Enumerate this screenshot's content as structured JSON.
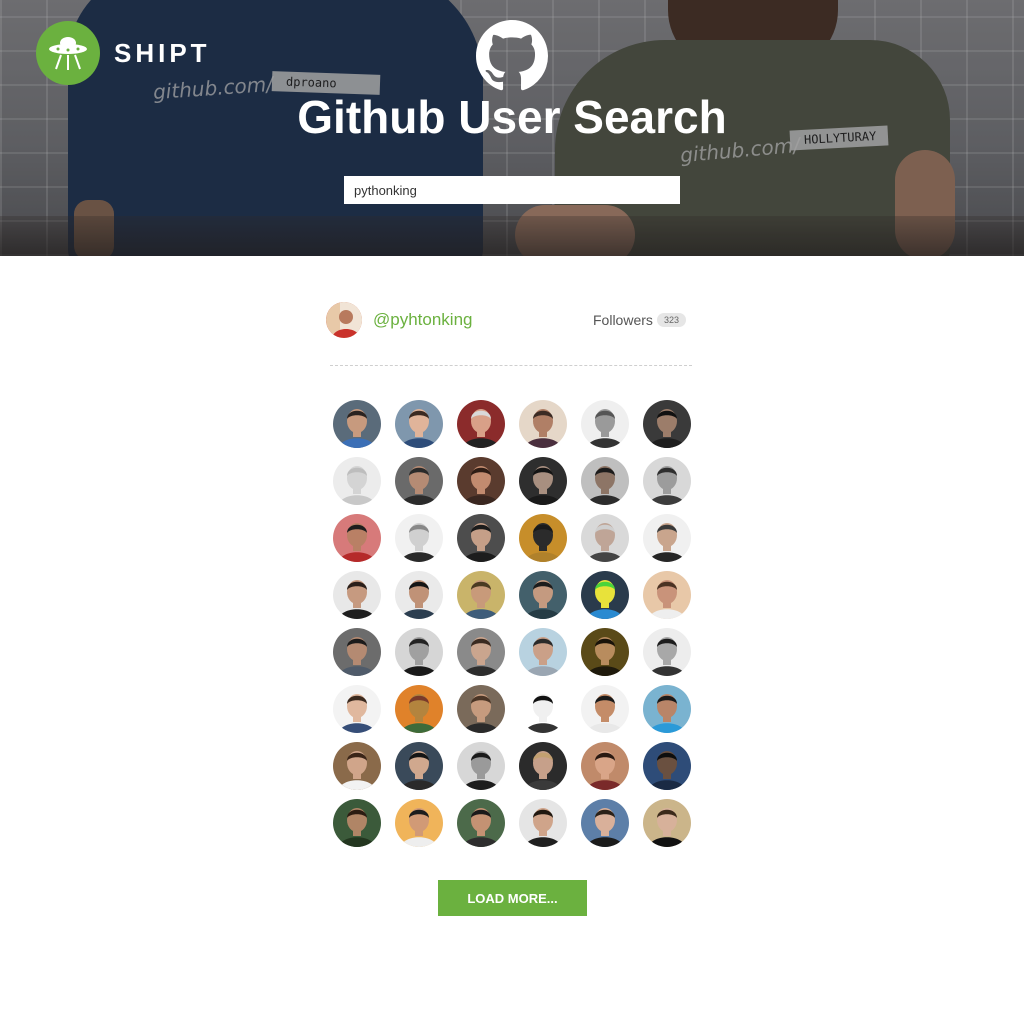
{
  "hero": {
    "brand": "SHIPT",
    "title": "Github User Search",
    "shirt_left_text": "github.com/",
    "shirt_left_tag": "dproano",
    "shirt_right_text": "github.com/",
    "shirt_right_tag": "HOLLYTURAY"
  },
  "search": {
    "value": "pythonking"
  },
  "profile": {
    "username": "@pyhtonking",
    "followers_label": "Followers",
    "followers_count": "323"
  },
  "followers": [
    {
      "bg": "#5a6b7a",
      "skin": "#c79a7e",
      "shirt": "#3b6fb6",
      "hair": "#2a2320"
    },
    {
      "bg": "#7f97ad",
      "skin": "#e0b49a",
      "shirt": "#2e4d7a",
      "hair": "#3a2a22"
    },
    {
      "bg": "#8b2b2b",
      "skin": "#d8a088",
      "shirt": "#222222",
      "hair": "#d9d9d9"
    },
    {
      "bg": "#e5d7c8",
      "skin": "#b07f66",
      "shirt": "#4a2f3e",
      "hair": "#3b2b24"
    },
    {
      "bg": "#efefef",
      "skin": "#9a9a9a",
      "shirt": "#333333",
      "hair": "#555555"
    },
    {
      "bg": "#3a3a3a",
      "skin": "#9c7d6a",
      "shirt": "#1e1e1e",
      "hair": "#111111"
    },
    {
      "bg": "#ececec",
      "skin": "#d4d4d4",
      "shirt": "#c8c8c8",
      "hair": "#bdbdbd"
    },
    {
      "bg": "#6a6a6a",
      "skin": "#b58b74",
      "shirt": "#2b2b2b",
      "hair": "#2a2a2a"
    },
    {
      "bg": "#5a3b2e",
      "skin": "#c28b6f",
      "shirt": "#3a2720",
      "hair": "#2f1d15"
    },
    {
      "bg": "#2e2e2e",
      "skin": "#a88f80",
      "shirt": "#1a1a1a",
      "hair": "#141414"
    },
    {
      "bg": "#bfbfbf",
      "skin": "#8d7566",
      "shirt": "#2c2c2c",
      "hair": "#1c1c1c"
    },
    {
      "bg": "#d8d8d8",
      "skin": "#9c9c9c",
      "shirt": "#3c3c3c",
      "hair": "#2e2e2e"
    },
    {
      "bg": "#d77a7a",
      "skin": "#b98065",
      "shirt": "#b52a2a",
      "hair": "#1e1e1e"
    },
    {
      "bg": "#f1f1f1",
      "skin": "#d0d0d0",
      "shirt": "#2a2a2a",
      "hair": "#888888"
    },
    {
      "bg": "#4d4d4d",
      "skin": "#c59f88",
      "shirt": "#1d1d1d",
      "hair": "#1b1b1b"
    },
    {
      "bg": "#c78e2a",
      "skin": "#2b2b2b",
      "shirt": "#b0812b",
      "hair": "#1a1a1a"
    },
    {
      "bg": "#d9d9d9",
      "skin": "#bfa597",
      "shirt": "#444444",
      "hair": "#cfcfcf"
    },
    {
      "bg": "#f0f0f0",
      "skin": "#c9a58d",
      "shirt": "#262626",
      "hair": "#3a3a3a"
    },
    {
      "bg": "#e8e8e8",
      "skin": "#c69a80",
      "shirt": "#1f1f1f",
      "hair": "#2a1f1a"
    },
    {
      "bg": "#eaeaea",
      "skin": "#c09277",
      "shirt": "#2c3e50",
      "hair": "#151515"
    },
    {
      "bg": "#c9b46a",
      "skin": "#c89a7a",
      "shirt": "#3f5d7a",
      "hair": "#4a3a22"
    },
    {
      "bg": "#43606b",
      "skin": "#c49a80",
      "shirt": "#263c45",
      "hair": "#1c1c1c"
    },
    {
      "bg": "#2a3b4c",
      "skin": "#e8e23a",
      "shirt": "#2a8ad1",
      "hair": "#4bd43a"
    },
    {
      "bg": "#e8c8a8",
      "skin": "#c9937a",
      "shirt": "#eeeeee",
      "hair": "#4a3223"
    },
    {
      "bg": "#6c6c6c",
      "skin": "#b48a72",
      "shirt": "#4f5b6a",
      "hair": "#1b1b1b"
    },
    {
      "bg": "#d6d6d6",
      "skin": "#a0a0a0",
      "shirt": "#1a1a1a",
      "hair": "#222222"
    },
    {
      "bg": "#8a8a8a",
      "skin": "#caa58e",
      "shirt": "#2d2d2d",
      "hair": "#3a2a20"
    },
    {
      "bg": "#b8d2e0",
      "skin": "#caa088",
      "shirt": "#9aa6b2",
      "hair": "#2a2a2a"
    },
    {
      "bg": "#5a4a18",
      "skin": "#b88c5e",
      "shirt": "#1f1a0c",
      "hair": "#191309"
    },
    {
      "bg": "#ededed",
      "skin": "#a8a8a8",
      "shirt": "#333333",
      "hair": "#1d1d1d"
    },
    {
      "bg": "#f3f3f3",
      "skin": "#e0b89e",
      "shirt": "#364e78",
      "hair": "#3b2a1f"
    },
    {
      "bg": "#e0822a",
      "skin": "#b3843e",
      "shirt": "#3d6b3a",
      "hair": "#7a3a2a"
    },
    {
      "bg": "#7a6a5a",
      "skin": "#c69b7e",
      "shirt": "#2a2a2a",
      "hair": "#4a3526"
    },
    {
      "bg": "#ffffff",
      "skin": "#f0f0f0",
      "shirt": "#333333",
      "hair": "#111111"
    },
    {
      "bg": "#f2f2f2",
      "skin": "#c48c68",
      "shirt": "#e8e8e8",
      "hair": "#1a1a1a"
    },
    {
      "bg": "#7ab3d0",
      "skin": "#b98568",
      "shirt": "#2b9ad8",
      "hair": "#1a1a1a"
    },
    {
      "bg": "#8a6a4a",
      "skin": "#d0a58a",
      "shirt": "#f2f2f2",
      "hair": "#3a2518"
    },
    {
      "bg": "#3a4a5a",
      "skin": "#d0a88e",
      "shirt": "#2a2a2a",
      "hair": "#151515"
    },
    {
      "bg": "#d7d7d7",
      "skin": "#9a9a9a",
      "shirt": "#1d1d1d",
      "hair": "#1a1a1a"
    },
    {
      "bg": "#2b2b2b",
      "skin": "#c6a08a",
      "shirt": "#3a3a3a",
      "hair": "#c2a070"
    },
    {
      "bg": "#c08a6a",
      "skin": "#d9a588",
      "shirt": "#7a2a2a",
      "hair": "#2a1a12"
    },
    {
      "bg": "#2e4c78",
      "skin": "#6a5040",
      "shirt": "#1a2a44",
      "hair": "#0d0d0d"
    },
    {
      "bg": "#3b5a3a",
      "skin": "#b08566",
      "shirt": "#23361f",
      "hair": "#2b1c12"
    },
    {
      "bg": "#f0b45a",
      "skin": "#d19a76",
      "shirt": "#eeeeee",
      "hair": "#1d1d1d"
    },
    {
      "bg": "#4c6a4a",
      "skin": "#c49273",
      "shirt": "#2e2e2e",
      "hair": "#1a1a1a"
    },
    {
      "bg": "#e5e5e5",
      "skin": "#cfa48a",
      "shirt": "#1f1f1f",
      "hair": "#201810"
    },
    {
      "bg": "#5d7fa8",
      "skin": "#d9b09a",
      "shirt": "#1b1b1b",
      "hair": "#2b2118"
    },
    {
      "bg": "#cbb58a",
      "skin": "#d7b19a",
      "shirt": "#111111",
      "hair": "#3b2a1a"
    }
  ],
  "load_more": {
    "label": "LOAD MORE..."
  }
}
